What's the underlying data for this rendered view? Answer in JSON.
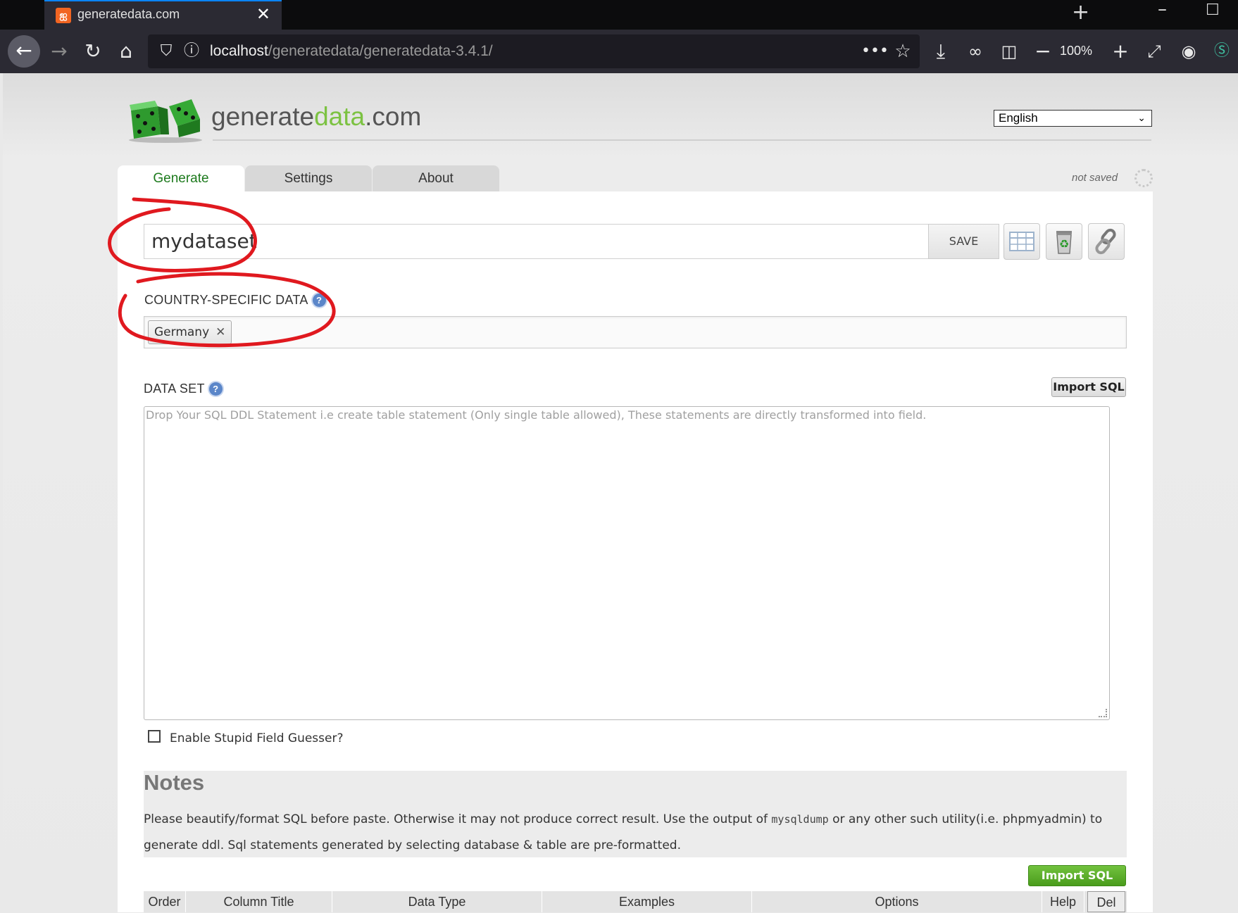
{
  "browser": {
    "tab_title": "generatedata.com",
    "favicon_glyph": "ஐ",
    "url_host": "localhost",
    "url_path": "/generatedata/generatedata-3.4.1/",
    "zoom": "100%"
  },
  "header": {
    "logo_part1": "generate",
    "logo_part2": "data",
    "logo_part3": ".com",
    "language": "English"
  },
  "tabs": [
    {
      "label": "Generate"
    },
    {
      "label": "Settings"
    },
    {
      "label": "About"
    }
  ],
  "status": {
    "save_state": "not saved"
  },
  "dataset": {
    "name": "mydataset",
    "save_label": "SAVE"
  },
  "country": {
    "label": "COUNTRY-SPECIFIC DATA",
    "selected": [
      "Germany"
    ]
  },
  "data_set": {
    "label": "DATA SET",
    "import_label": "Import SQL",
    "placeholder": "Drop Your SQL DDL Statement i.e create table statement (Only single table allowed), These statements are directly transformed into field."
  },
  "guesser": {
    "label": "Enable Stupid Field Guesser?"
  },
  "notes": {
    "title": "Notes",
    "text_before": "Please beautify/format SQL before paste. Otherwise it may not produce correct result. Use the output of ",
    "code": "mysqldump",
    "text_after": " or any other such utility(i.e. phpmyadmin) to generate ddl. Sql statements generated by selecting database & table are pre-formatted."
  },
  "import_sql_green": "Import SQL",
  "table": {
    "columns": [
      "Order",
      "Column Title",
      "Data Type",
      "Examples",
      "Options",
      "Help",
      "Del"
    ]
  },
  "colors": {
    "accent_green": "#7cc242",
    "annotation_red": "#e0191f",
    "help_blue": "#5b86c9"
  }
}
